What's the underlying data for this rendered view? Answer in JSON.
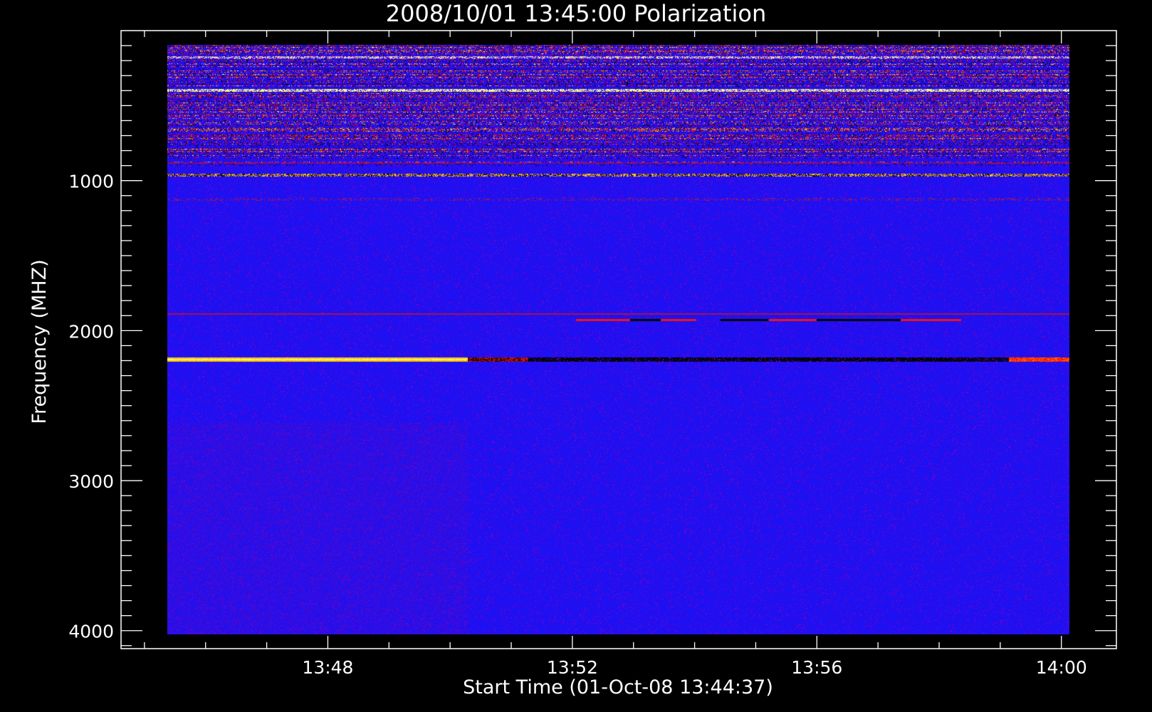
{
  "chart_data": {
    "type": "heatmap",
    "title": "2008/10/01 13:45:00 Polarization",
    "xlabel": "Start Time (01-Oct-08 13:44:37)",
    "ylabel": "Frequency (MHZ)",
    "x_tick_labels": [
      "13:48",
      "13:52",
      "13:56",
      "14:00"
    ],
    "x_tick_minutes": [
      48,
      52,
      56,
      60
    ],
    "x_minor_minutes": [
      45,
      46,
      47,
      48,
      49,
      50,
      51,
      52,
      53,
      54,
      55,
      56,
      57,
      58,
      59,
      60
    ],
    "x_range_minutes": [
      44.617,
      60.9
    ],
    "data_x_range_minutes": [
      45,
      60
    ],
    "y_tick_labels": [
      "1000",
      "2000",
      "3000",
      "4000"
    ],
    "y_ticks": [
      1000,
      2000,
      3000,
      4000
    ],
    "y_minor_step": 100,
    "y_range": [
      0,
      4120
    ],
    "y_inverted": true,
    "data_y_range": [
      100,
      4000
    ],
    "colormap": [
      "#000000",
      "#0000ff",
      "#ff0000",
      "#ffff00",
      "#ffffff"
    ],
    "background_color": "#1d10f2",
    "features": [
      {
        "kind": "noise-band",
        "freq": [
          100,
          900
        ],
        "intensity": 0.55
      },
      {
        "kind": "bright-line",
        "freq": 180,
        "intensity": 0.8
      },
      {
        "kind": "bright-line",
        "freq": 400,
        "intensity": 1.0
      },
      {
        "kind": "dark-line",
        "freq": 650
      },
      {
        "kind": "red-line",
        "freq": 880
      },
      {
        "kind": "bright-line",
        "freq": 960,
        "intensity": 0.85
      },
      {
        "kind": "red-line",
        "freq": 1120
      },
      {
        "kind": "red-line",
        "freq": 1880
      },
      {
        "kind": "red-dark-segments",
        "freq": 1920
      },
      {
        "kind": "bright-band",
        "freq": 2180,
        "time": [
          45,
          50
        ],
        "intensity": 1.0
      },
      {
        "kind": "dark-band",
        "freq": 2180,
        "time": [
          51,
          59
        ]
      },
      {
        "kind": "red-band",
        "freq": 2180,
        "time": [
          59,
          60
        ]
      }
    ]
  }
}
